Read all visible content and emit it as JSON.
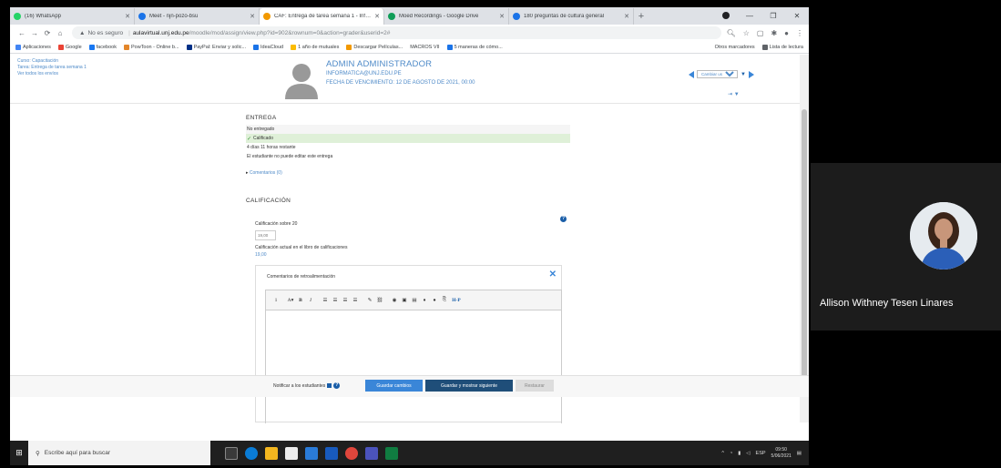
{
  "browser": {
    "tabs": [
      {
        "title": "(16) WhatsApp",
        "color": "#25d366"
      },
      {
        "title": "Meet - njn-pozo-bsu",
        "color": "#1a73e8"
      },
      {
        "title": "CAF: Entrega de tarea semana 1 - Informática",
        "color": "#f29900",
        "active": true
      },
      {
        "title": "Moed Recordings - Google Drive",
        "color": "#0f9d58"
      },
      {
        "title": "180 preguntas de cultura general",
        "color": "#1a73e8"
      }
    ],
    "url": {
      "warning": "No es seguro",
      "domain": "aulavirtual.unj.edu.pe",
      "path": "/moodle/mod/assign/view.php?id=902&rownum=0&action=grader&userid=2#"
    },
    "bookmarks": [
      "Aplicaciones",
      "Google",
      "facebook",
      "PowToon - Online b...",
      "PayPal: Enviar y solic...",
      "IdeaCloud",
      "1 año de mutuales",
      "Descargar Películas...",
      "MACROS VII",
      "5 maneras de cómo..."
    ],
    "bookmarks_right": [
      "Otros marcadores",
      "Lista de lectura"
    ]
  },
  "moodle": {
    "breadcrumb": [
      "Curso: Capacitación",
      "Tarea: Entrega de tarea semana 1",
      "Ver todos los envíos"
    ],
    "user": {
      "name": "ADMIN ADMINISTRADOR",
      "email": "INFORMATICA@UNJ.EDU.PE",
      "due_date": "FECHA DE VENCIMIENTO: 12 DE AGOSTO DE 2021, 00:00"
    },
    "change_user": {
      "label": "Cambiar usuario"
    },
    "submission": {
      "section_title": "ENTREGA",
      "rows": [
        "No entregado",
        "Calificado",
        "4 días 11 horas restante",
        "El estudiante no puede editar este entrega"
      ],
      "comments_link": "Comentarios (0)"
    },
    "grade": {
      "section_title": "CALIFICACIÓN",
      "label": "Calificación sobre 20",
      "placeholder": "19,00",
      "current_label": "Calificación actual en el libro de calificaciones",
      "current_value": "19,00"
    },
    "feedback": {
      "title": "Comentarios de retroalimentación",
      "toolbar": [
        "1",
        "A▾",
        "B",
        "I",
        "☰",
        "☰",
        "☰",
        "☰",
        "✎",
        "⛓",
        "◉",
        "▣",
        "▤",
        "♦",
        "●",
        "⎘",
        "H-P"
      ]
    },
    "footer": {
      "notify_label": "Notificar a los estudiantes",
      "save": "Guardar cambios",
      "save_next": "Guardar y mostrar siguiente",
      "reset": "Restaurar"
    }
  },
  "taskbar": {
    "search_placeholder": "Escribe aquí para buscar",
    "lang": "ESP",
    "time": "09:50",
    "date": "5/06/2021"
  },
  "video": {
    "participant_name": "Allison Withney Tesen Linares"
  }
}
